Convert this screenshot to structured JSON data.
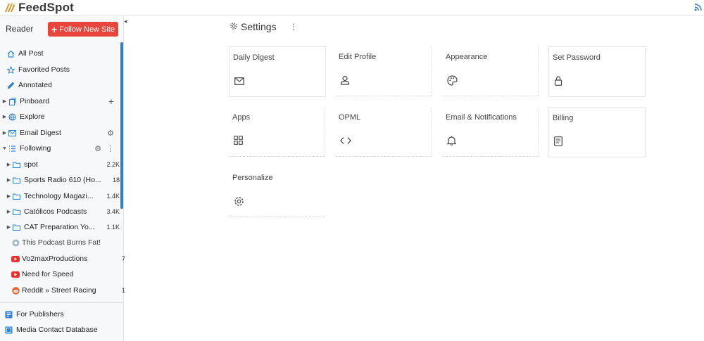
{
  "app": {
    "name": "FeedSpot"
  },
  "sidebar": {
    "reader_label": "Reader",
    "follow_button": "Follow New Site",
    "collapse_glyph": "◂",
    "items": [
      {
        "label": "All Post",
        "icon": "home-icon"
      },
      {
        "label": "Favorited Posts",
        "icon": "star-icon"
      },
      {
        "label": "Annotated",
        "icon": "pencil-icon"
      },
      {
        "label": "Pinboard",
        "icon": "pinboard-icon"
      },
      {
        "label": "Explore",
        "icon": "globe-icon"
      },
      {
        "label": "Email Digest",
        "icon": "envelope-icon"
      },
      {
        "label": "Following",
        "icon": "list-icon"
      }
    ],
    "folders": [
      {
        "label": "spot",
        "count": "2.2K"
      },
      {
        "label": "Sports Radio 610 (Ho...",
        "count": "18"
      },
      {
        "label": "Technology Magazi...",
        "count": "1.4K"
      },
      {
        "label": "Católicos Podcasts",
        "count": "3.4K"
      },
      {
        "label": "CAT Preparation Yo...",
        "count": "1.1K"
      }
    ],
    "feeds": [
      {
        "label": "This Podcast Burns Fat!",
        "count": "",
        "icon": "podcast-icon"
      },
      {
        "label": "Vo2maxProductions",
        "count": "7",
        "icon": "youtube-icon"
      },
      {
        "label": "Need for Speed",
        "count": "",
        "icon": "youtube-icon"
      },
      {
        "label": "Reddit » Street Racing",
        "count": "1",
        "icon": "reddit-icon"
      }
    ],
    "footer": [
      {
        "label": "For Publishers",
        "icon": "publisher-icon"
      },
      {
        "label": "Media Contact Database",
        "icon": "database-icon"
      }
    ]
  },
  "settings": {
    "title": "Settings",
    "cards": [
      {
        "label": "Daily Digest",
        "icon": "envelope-icon"
      },
      {
        "label": "Edit Profile",
        "icon": "user-icon"
      },
      {
        "label": "Appearance",
        "icon": "palette-icon"
      },
      {
        "label": "Set Password",
        "icon": "lock-icon"
      },
      {
        "label": "Apps",
        "icon": "apps-grid-icon"
      },
      {
        "label": "OPML",
        "icon": "code-icon"
      },
      {
        "label": "Email & Notifications",
        "icon": "bell-icon"
      },
      {
        "label": "Billing",
        "icon": "document-icon"
      },
      {
        "label": "Personalize",
        "icon": "gear-icon"
      }
    ]
  },
  "colors": {
    "accent": "#2f7fd4",
    "brand_red": "#e8453c",
    "logo_orange": "#e0902a"
  }
}
